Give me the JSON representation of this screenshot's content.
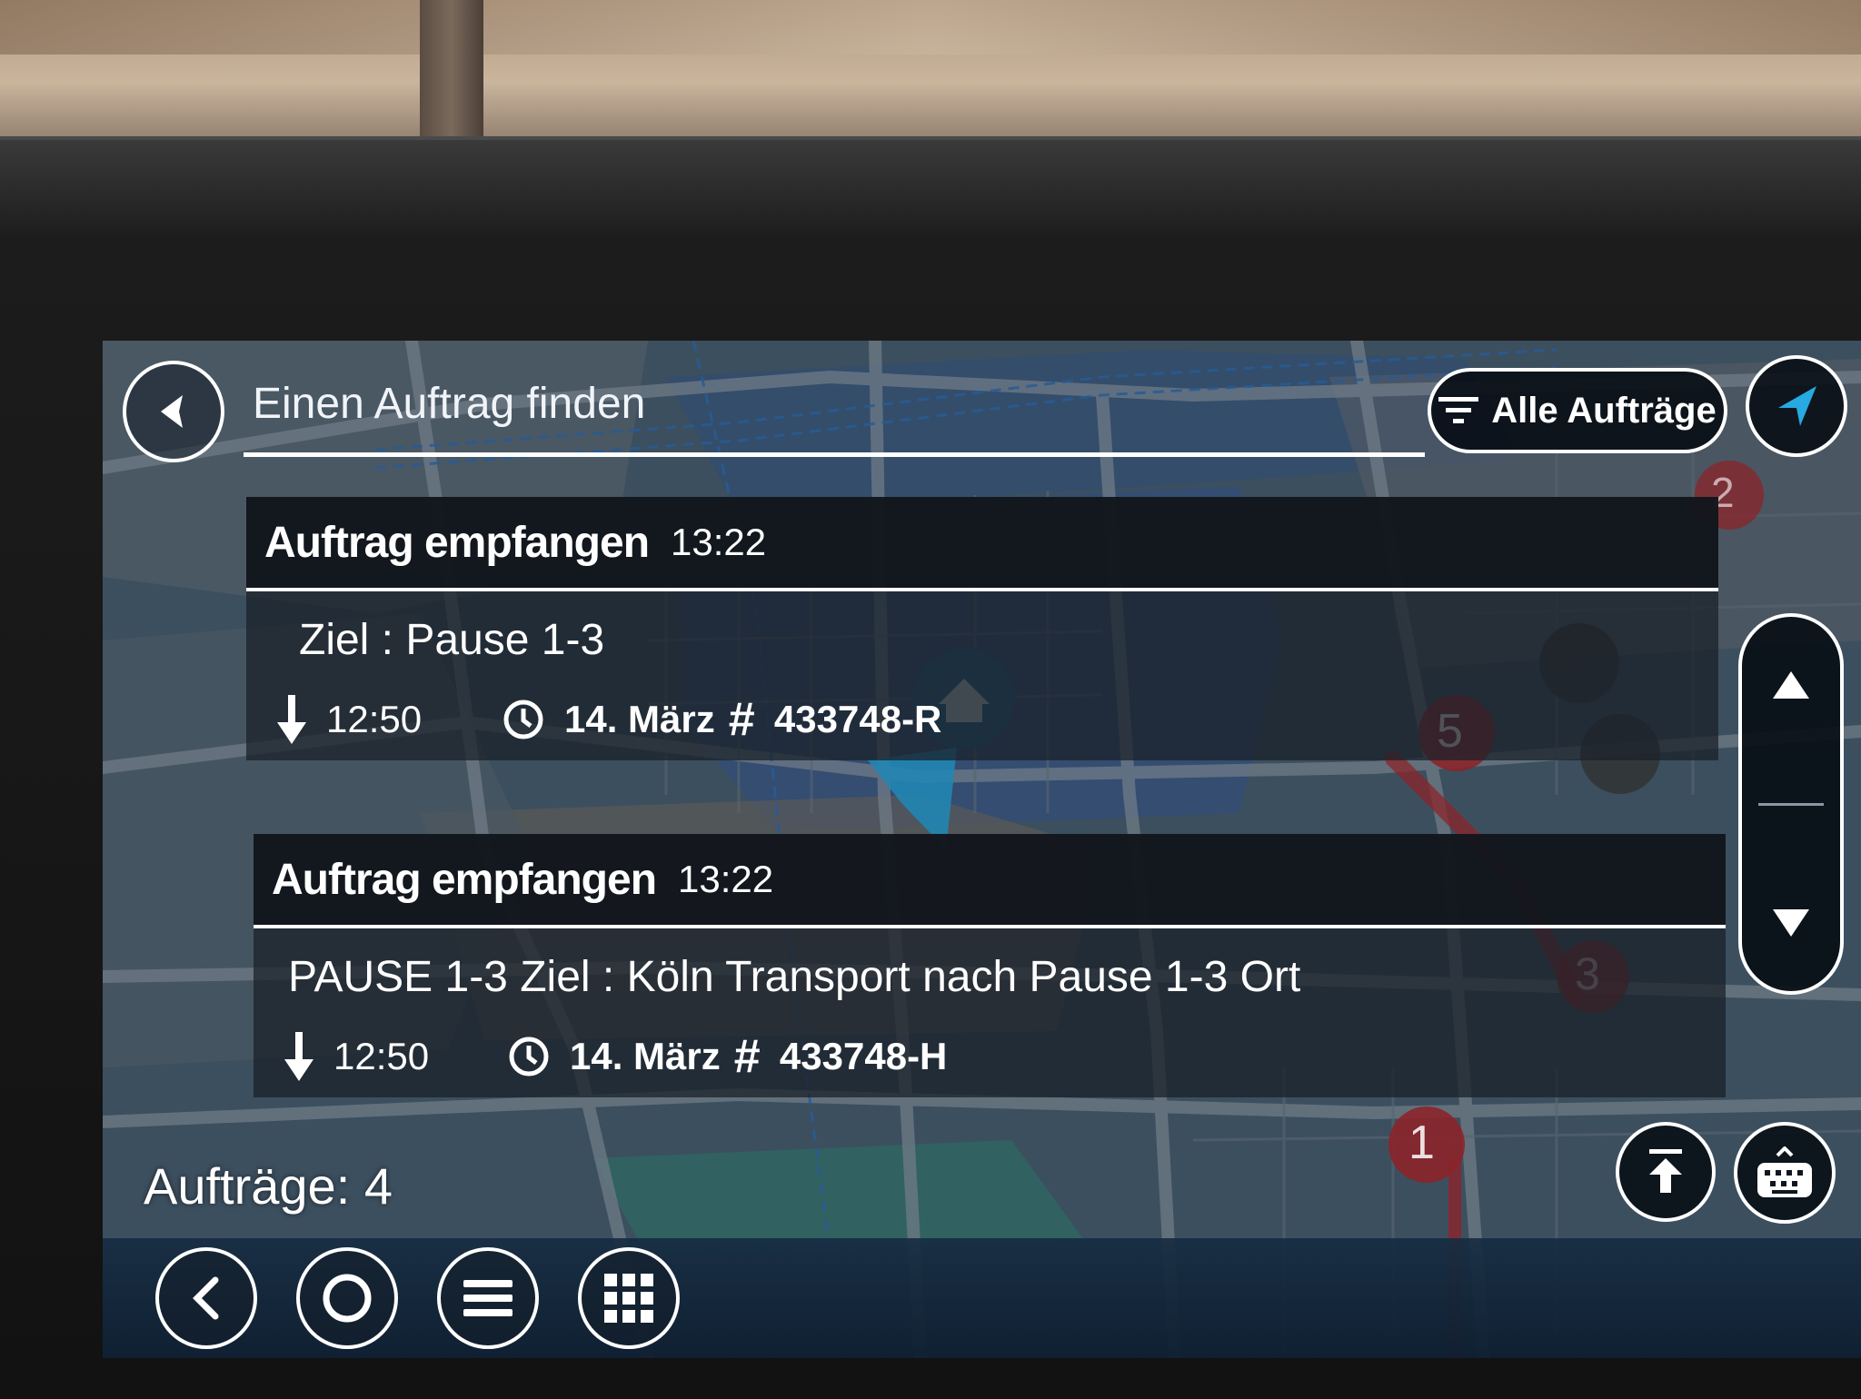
{
  "header": {
    "title": "Einen Auftrag finden",
    "filter_label": "Alle Aufträge"
  },
  "orders": [
    {
      "heading": "Auftrag empfangen",
      "time": "13:22",
      "description": "Ziel : Pause 1-3",
      "arrival": "12:50",
      "date": "14. März",
      "number": "433748-R"
    },
    {
      "heading": "Auftrag empfangen",
      "time": "13:22",
      "description": "PAUSE 1-3  Ziel :  Köln  Transport nach Pause 1-3 Ort",
      "arrival": "12:50",
      "date": "14. März",
      "number": "433748-H"
    }
  ],
  "footer": {
    "count_label": "Aufträge: 4"
  },
  "map": {
    "markers": [
      "1",
      "2",
      "3",
      "5"
    ]
  },
  "colors": {
    "accent": "#27a9e1",
    "marker": "#b3262b",
    "panel": "#0e1620"
  },
  "icons": {
    "back": "back-arrow-icon",
    "filter": "filter-icon",
    "location": "location-arrow-icon",
    "arrival": "arrow-down-icon",
    "clock": "clock-icon",
    "hash": "hash-icon"
  }
}
